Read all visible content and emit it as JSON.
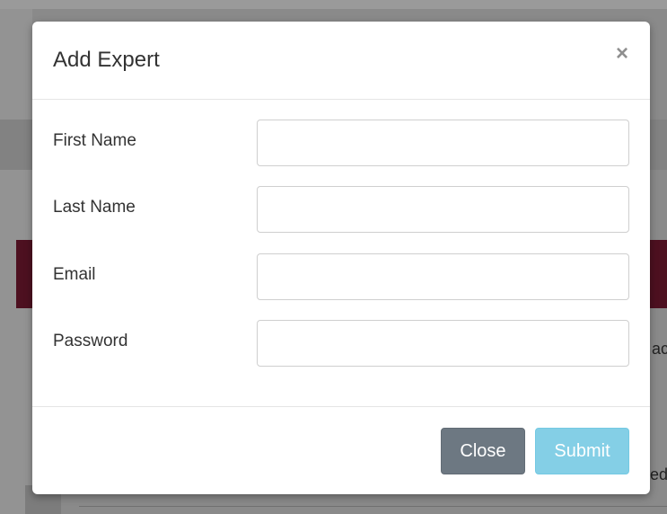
{
  "modal": {
    "title": "Add Expert",
    "close_icon": "close-icon",
    "close_glyph": "×",
    "fields": [
      {
        "label": "First Name",
        "value": "",
        "placeholder": ""
      },
      {
        "label": "Last Name",
        "value": "",
        "placeholder": ""
      },
      {
        "label": "Email",
        "value": "",
        "placeholder": ""
      },
      {
        "label": "Password",
        "value": "",
        "placeholder": ""
      }
    ],
    "buttons": {
      "close_label": "Close",
      "submit_label": "Submit"
    }
  },
  "background": {
    "partial_text_1": "ac",
    "partial_text_2": "ed"
  },
  "colors": {
    "close_button": "#6d7882",
    "submit_button": "#5bc0de",
    "backdrop_band": "#4d1020"
  }
}
